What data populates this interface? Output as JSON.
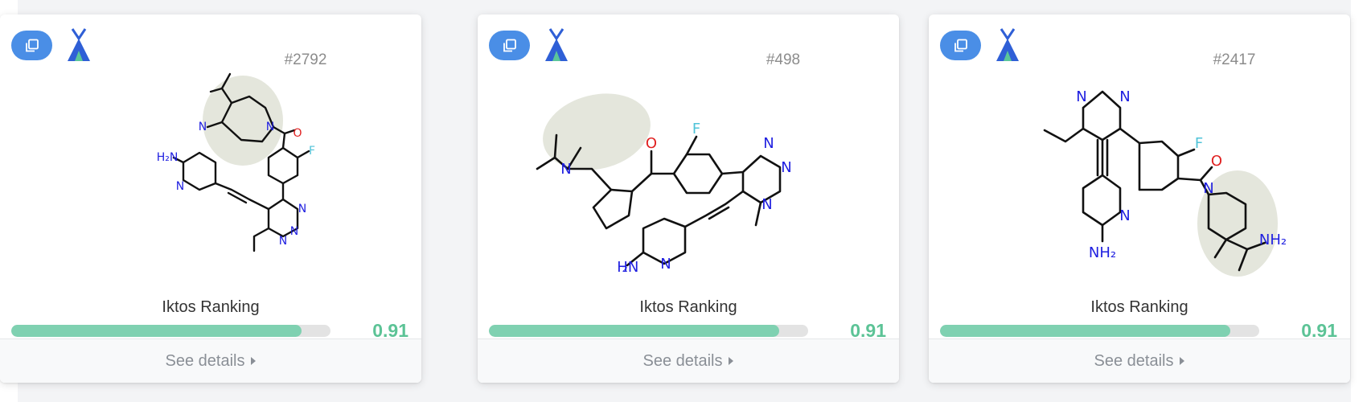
{
  "colors": {
    "accent": "#4a8ee6",
    "logo_blue": "#2f5fd6",
    "logo_green": "#5bc69a",
    "score": "#5cc396",
    "progress_fill": "#7fd1b1",
    "bond": "#111111",
    "nitrogen": "#1f1fe0",
    "oxygen": "#e02020",
    "fluorine": "#4fc3d8",
    "highlight": "#e4e6dc"
  },
  "icons": {
    "copy": "copy-icon",
    "logo": "iktos-logo-icon",
    "caret": "caret-right-icon"
  },
  "cards": [
    {
      "id": "#498",
      "ranking_label": "Iktos Ranking",
      "score": "0.91",
      "score_value": 0.91,
      "details_label": "See details"
    },
    {
      "id": "#2417",
      "ranking_label": "Iktos Ranking",
      "score": "0.91",
      "score_value": 0.91,
      "details_label": "See details"
    },
    {
      "id": "#2792",
      "ranking_label": "Iktos Ranking",
      "score": "0.91",
      "score_value": 0.91,
      "details_label": "See details"
    }
  ]
}
